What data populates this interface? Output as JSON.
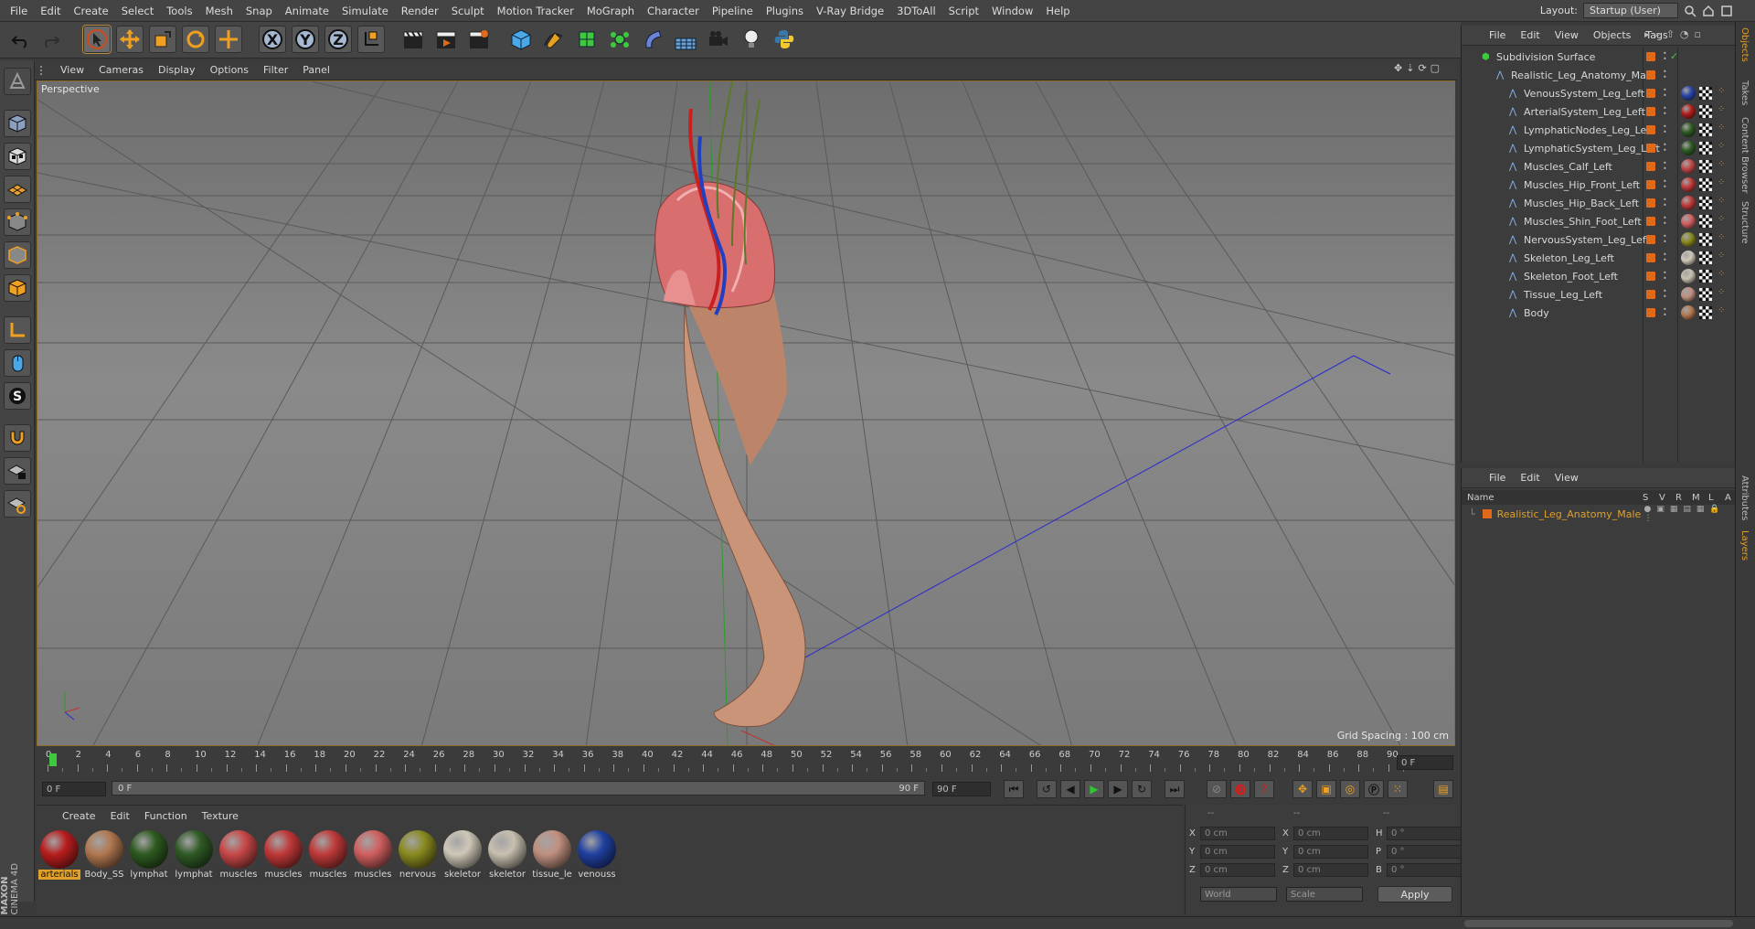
{
  "menu": [
    "File",
    "Edit",
    "Create",
    "Select",
    "Tools",
    "Mesh",
    "Snap",
    "Animate",
    "Simulate",
    "Render",
    "Sculpt",
    "Motion Tracker",
    "MoGraph",
    "Character",
    "Pipeline",
    "Plugins",
    "V-Ray Bridge",
    "3DToAll",
    "Script",
    "Window",
    "Help"
  ],
  "layout": {
    "label": "Layout:",
    "value": "Startup (User)"
  },
  "toolbar": {
    "x": "X",
    "y": "Y",
    "z": "Z"
  },
  "viewport_menu": [
    "View",
    "Cameras",
    "Display",
    "Options",
    "Filter",
    "Panel"
  ],
  "viewport": {
    "label": "Perspective",
    "grid_spacing": "Grid Spacing : 100 cm"
  },
  "timeline": {
    "ticks": [
      "0",
      "2",
      "4",
      "6",
      "8",
      "10",
      "12",
      "14",
      "16",
      "18",
      "20",
      "22",
      "24",
      "26",
      "28",
      "30",
      "32",
      "34",
      "36",
      "38",
      "40",
      "42",
      "44",
      "46",
      "48",
      "50",
      "52",
      "54",
      "56",
      "58",
      "60",
      "62",
      "64",
      "66",
      "68",
      "70",
      "72",
      "74",
      "76",
      "78",
      "80",
      "82",
      "84",
      "86",
      "88",
      "90"
    ],
    "current_frame": "0 F",
    "start": "0 F",
    "slider_start": "0 F",
    "slider_end": "90 F",
    "end": "90 F"
  },
  "materials": {
    "menu": [
      "Create",
      "Edit",
      "Function",
      "Texture"
    ],
    "items": [
      {
        "label": "arterials",
        "color": "#b81e1e",
        "selected": true
      },
      {
        "label": "Body_SS",
        "color": "#b07850"
      },
      {
        "label": "lymphat",
        "color": "#2e5a20"
      },
      {
        "label": "lymphat",
        "color": "#305a25"
      },
      {
        "label": "muscles",
        "color": "#c84848"
      },
      {
        "label": "muscles",
        "color": "#c03838"
      },
      {
        "label": "muscles",
        "color": "#c03a3a"
      },
      {
        "label": "muscles",
        "color": "#d06060"
      },
      {
        "label": "nervous",
        "color": "#8a8a20"
      },
      {
        "label": "skeletor",
        "color": "#cfc8b8"
      },
      {
        "label": "skeletor",
        "color": "#c8c0b0"
      },
      {
        "label": "tissue_le",
        "color": "#c09080"
      },
      {
        "label": "venouss",
        "color": "#2040a0"
      }
    ]
  },
  "coords": {
    "header": [
      "--",
      "--",
      "--"
    ],
    "rows": [
      {
        "a": "X",
        "av": "0 cm",
        "b": "X",
        "bv": "0 cm",
        "c": "H",
        "cv": "0 °"
      },
      {
        "a": "Y",
        "av": "0 cm",
        "b": "Y",
        "bv": "0 cm",
        "c": "P",
        "cv": "0 °"
      },
      {
        "a": "Z",
        "av": "0 cm",
        "b": "Z",
        "bv": "0 cm",
        "c": "B",
        "cv": "0 °"
      }
    ],
    "world": "World",
    "scale": "Scale",
    "apply": "Apply"
  },
  "objects": {
    "menu": [
      "File",
      "Edit",
      "View",
      "Objects",
      "Tags"
    ],
    "root": "Subdivision Surface",
    "group": "Realistic_Leg_Anatomy_Male",
    "items": [
      {
        "name": "VenousSystem_Leg_Left",
        "tag": "#2a44a8"
      },
      {
        "name": "ArterialSystem_Leg_Left",
        "tag": "#b01e1e"
      },
      {
        "name": "LymphaticNodes_Leg_Left",
        "tag": "#2e5a22"
      },
      {
        "name": "LymphaticSystem_Leg_Left",
        "tag": "#2e5a22"
      },
      {
        "name": "Muscles_Calf_Left",
        "tag": "#c04848"
      },
      {
        "name": "Muscles_Hip_Front_Left",
        "tag": "#c03a3a"
      },
      {
        "name": "Muscles_Hip_Back_Left",
        "tag": "#c03a3a"
      },
      {
        "name": "Muscles_Shin_Foot_Left",
        "tag": "#d06060"
      },
      {
        "name": "NervousSystem_Leg_Left",
        "tag": "#8a8a20"
      },
      {
        "name": "Skeleton_Leg_Left",
        "tag": "#cfc8b8"
      },
      {
        "name": "Skeleton_Foot_Left",
        "tag": "#c8c0b0"
      },
      {
        "name": "Tissue_Leg_Left",
        "tag": "#c09080"
      },
      {
        "name": "Body",
        "tag": "#b07850"
      }
    ]
  },
  "layers": {
    "menu": [
      "File",
      "Edit",
      "View"
    ],
    "header": {
      "name": "Name",
      "s": "S",
      "v": "V",
      "r": "R",
      "m": "M",
      "l": "L",
      "a": "A"
    },
    "item": "Realistic_Leg_Anatomy_Male"
  },
  "side_tabs": [
    "Objects",
    "Takes",
    "Content Browser",
    "Structure",
    "Attributes",
    "Layers"
  ],
  "brand": {
    "maxon": "MAXON",
    "product": "CINEMA 4D"
  },
  "colors": {
    "accent": "#e0a02a",
    "orange": "#e06a1a"
  }
}
